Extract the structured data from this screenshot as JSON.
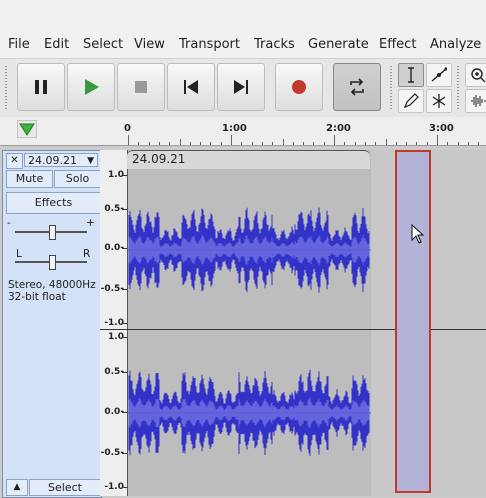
{
  "menu": [
    "File",
    "Edit",
    "Select",
    "View",
    "Transport",
    "Tracks",
    "Generate",
    "Effect",
    "Analyze"
  ],
  "timeline": {
    "labels": [
      "0",
      "1:00",
      "2:00",
      "3:00"
    ]
  },
  "track": {
    "name": "24.09.21",
    "clip_name": "24.09.21",
    "mute_label": "Mute",
    "solo_label": "Solo",
    "effects_label": "Effects",
    "gain_minus": "-",
    "gain_plus": "+",
    "pan_left": "L",
    "pan_right": "R",
    "info_line1": "Stereo, 48000Hz",
    "info_line2": "32-bit float",
    "select_label": "Select",
    "collapse_symbol": "▲",
    "close_symbol": "✕",
    "menu_symbol": "▼"
  },
  "vruler_labels": [
    "1.0",
    "0.5-",
    "0.0-",
    "-0.5-",
    "-1.0"
  ],
  "colors": {
    "waveform": "#3232c8",
    "waveform_rms": "#6464dc",
    "selection_border": "#c0392b",
    "selection_fill": "#b3b3d8",
    "play_green": "#3c9a3c",
    "record_red": "#c0392b"
  },
  "icons": [
    "pause-icon",
    "play-icon",
    "stop-icon",
    "skip-start-icon",
    "skip-end-icon",
    "record-icon",
    "loop-icon",
    "select-tool-icon",
    "envelope-tool-icon",
    "draw-tool-icon",
    "multi-tool-icon",
    "zoom-in-icon",
    "waveform-icon"
  ]
}
